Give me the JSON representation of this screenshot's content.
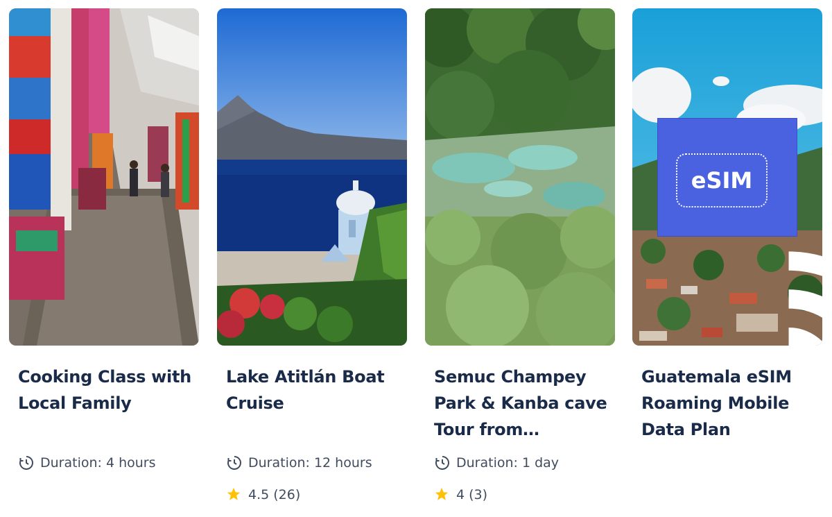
{
  "cards": [
    {
      "title": "Cooking Class with Local Family",
      "duration": "Duration: 4 hours",
      "image": "market-street-photo"
    },
    {
      "title": "Lake Atitlán Boat Cruise",
      "duration": "Duration: 12 hours",
      "rating": "4.5 (26)",
      "image": "lake-volcano-photo"
    },
    {
      "title": "Semuc Champey Park & Kanba cave Tour from…",
      "duration": "Duration: 1 day",
      "rating": "4 (3)",
      "image": "turquoise-pools-photo"
    },
    {
      "title": "Guatemala eSIM Roaming Mobile Data Plan",
      "badge_text": "eSIM",
      "image": "town-aerial-photo"
    }
  ],
  "icons": {
    "duration": "clock-icon",
    "rating": "star-icon"
  },
  "colors": {
    "title": "#1a2b49",
    "meta": "#3f4b5f",
    "star": "#ffc107",
    "esim_badge": "#4a62e0"
  }
}
